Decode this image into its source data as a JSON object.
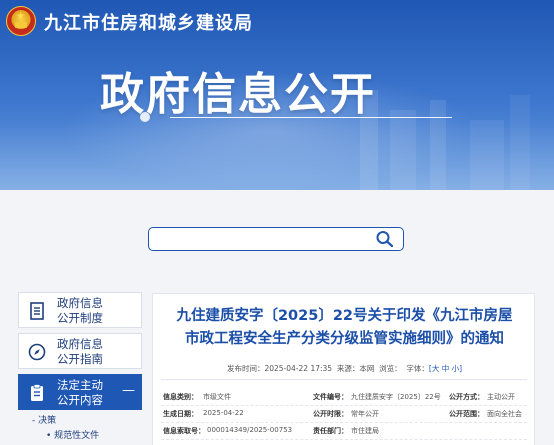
{
  "header": {
    "site_name": "九江市住房和城乡建设局",
    "hero_title": "政府信息公开"
  },
  "search": {
    "placeholder": ""
  },
  "sidebar": {
    "items": [
      {
        "label_line1": "政府信息",
        "label_line2": "公开制度",
        "icon": "document-icon"
      },
      {
        "label_line1": "政府信息",
        "label_line2": "公开指南",
        "icon": "compass-icon"
      },
      {
        "label_line1": "法定主动",
        "label_line2": "公开内容",
        "icon": "clipboard-icon",
        "toggle": "—"
      }
    ],
    "sub_items": [
      {
        "label": "- 决策"
      },
      {
        "label": "• 规范性文件"
      }
    ]
  },
  "document": {
    "title_line1": "九住建质安字〔2025〕22号关于印发《九江市房屋",
    "title_line2": "市政工程安全生产分类分级监管实施细则》的通知",
    "publish_label": "发布时间：",
    "publish_time": "2025-04-22 17:35",
    "source_label": "来源：",
    "source": "本网",
    "views_label": "浏览：",
    "views": "",
    "font_label": "字体：",
    "font_sizes": "[大 中 小]"
  },
  "info_table": {
    "rows": [
      [
        {
          "key": "信息类别：",
          "value": "市级文件"
        },
        {
          "key": "文件编号：",
          "value": "九住建质安字〔2025〕22号"
        },
        {
          "key": "公开方式：",
          "value": "主动公开"
        }
      ],
      [
        {
          "key": "生成日期：",
          "value": "2025-04-22"
        },
        {
          "key": "公开时限：",
          "value": "常年公开"
        },
        {
          "key": "公开范围：",
          "value": "面向全社会"
        }
      ],
      [
        {
          "key": "信息索取号：",
          "value": "000014349/2025-00753"
        },
        {
          "key": "责任部门：",
          "value": "市住建局"
        },
        {
          "key": "",
          "value": ""
        }
      ]
    ]
  },
  "colors": {
    "brand_blue": "#1f58b4",
    "title_blue": "#1c4fa8",
    "emblem_red": "#d8331f",
    "emblem_gold": "#f3c63a"
  }
}
